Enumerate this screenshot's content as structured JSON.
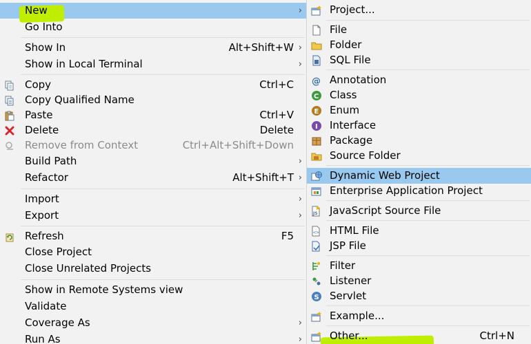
{
  "main_menu": {
    "items": [
      {
        "label": "New",
        "shortcut": "",
        "submenu": true
      },
      {
        "label": "Go Into",
        "shortcut": "",
        "submenu": false
      },
      {
        "label": "Show In",
        "shortcut": "Alt+Shift+W",
        "submenu": true
      },
      {
        "label": "Show in Local Terminal",
        "shortcut": "",
        "submenu": true
      },
      {
        "label": "Copy",
        "shortcut": "Ctrl+C",
        "submenu": false
      },
      {
        "label": "Copy Qualified Name",
        "shortcut": "",
        "submenu": false
      },
      {
        "label": "Paste",
        "shortcut": "Ctrl+V",
        "submenu": false
      },
      {
        "label": "Delete",
        "shortcut": "Delete",
        "submenu": false
      },
      {
        "label": "Remove from Context",
        "shortcut": "Ctrl+Alt+Shift+Down",
        "submenu": false
      },
      {
        "label": "Build Path",
        "shortcut": "",
        "submenu": true
      },
      {
        "label": "Refactor",
        "shortcut": "Alt+Shift+T",
        "submenu": true
      },
      {
        "label": "Import",
        "shortcut": "",
        "submenu": true
      },
      {
        "label": "Export",
        "shortcut": "",
        "submenu": true
      },
      {
        "label": "Refresh",
        "shortcut": "F5",
        "submenu": false
      },
      {
        "label": "Close Project",
        "shortcut": "",
        "submenu": false
      },
      {
        "label": "Close Unrelated Projects",
        "shortcut": "",
        "submenu": false
      },
      {
        "label": "Show in Remote Systems view",
        "shortcut": "",
        "submenu": false
      },
      {
        "label": "Validate",
        "shortcut": "",
        "submenu": false
      },
      {
        "label": "Coverage As",
        "shortcut": "",
        "submenu": true
      },
      {
        "label": "Run As",
        "shortcut": "",
        "submenu": true
      }
    ]
  },
  "sub_menu": {
    "items": [
      {
        "label": "Project...",
        "shortcut": ""
      },
      {
        "label": "File",
        "shortcut": ""
      },
      {
        "label": "Folder",
        "shortcut": ""
      },
      {
        "label": "SQL File",
        "shortcut": ""
      },
      {
        "label": "Annotation",
        "shortcut": ""
      },
      {
        "label": "Class",
        "shortcut": ""
      },
      {
        "label": "Enum",
        "shortcut": ""
      },
      {
        "label": "Interface",
        "shortcut": ""
      },
      {
        "label": "Package",
        "shortcut": ""
      },
      {
        "label": "Source Folder",
        "shortcut": ""
      },
      {
        "label": "Dynamic Web Project",
        "shortcut": ""
      },
      {
        "label": "Enterprise Application Project",
        "shortcut": ""
      },
      {
        "label": "JavaScript Source File",
        "shortcut": ""
      },
      {
        "label": "HTML File",
        "shortcut": ""
      },
      {
        "label": "JSP File",
        "shortcut": ""
      },
      {
        "label": "Filter",
        "shortcut": ""
      },
      {
        "label": "Listener",
        "shortcut": ""
      },
      {
        "label": "Servlet",
        "shortcut": ""
      },
      {
        "label": "Example...",
        "shortcut": ""
      },
      {
        "label": "Other...",
        "shortcut": "Ctrl+N"
      }
    ]
  },
  "icons": {
    "copy": "copy-icon",
    "copy_qualified": "copy-qualified-name-icon",
    "paste": "paste-icon",
    "delete": "delete-icon",
    "remove_context": "remove-context-icon",
    "refresh": "refresh-icon"
  },
  "colors": {
    "menu_bg": "#f2f2f2",
    "selection": "#99c9ef",
    "highlighter": "#bfee00",
    "disabled_text": "#8a8a8a"
  }
}
